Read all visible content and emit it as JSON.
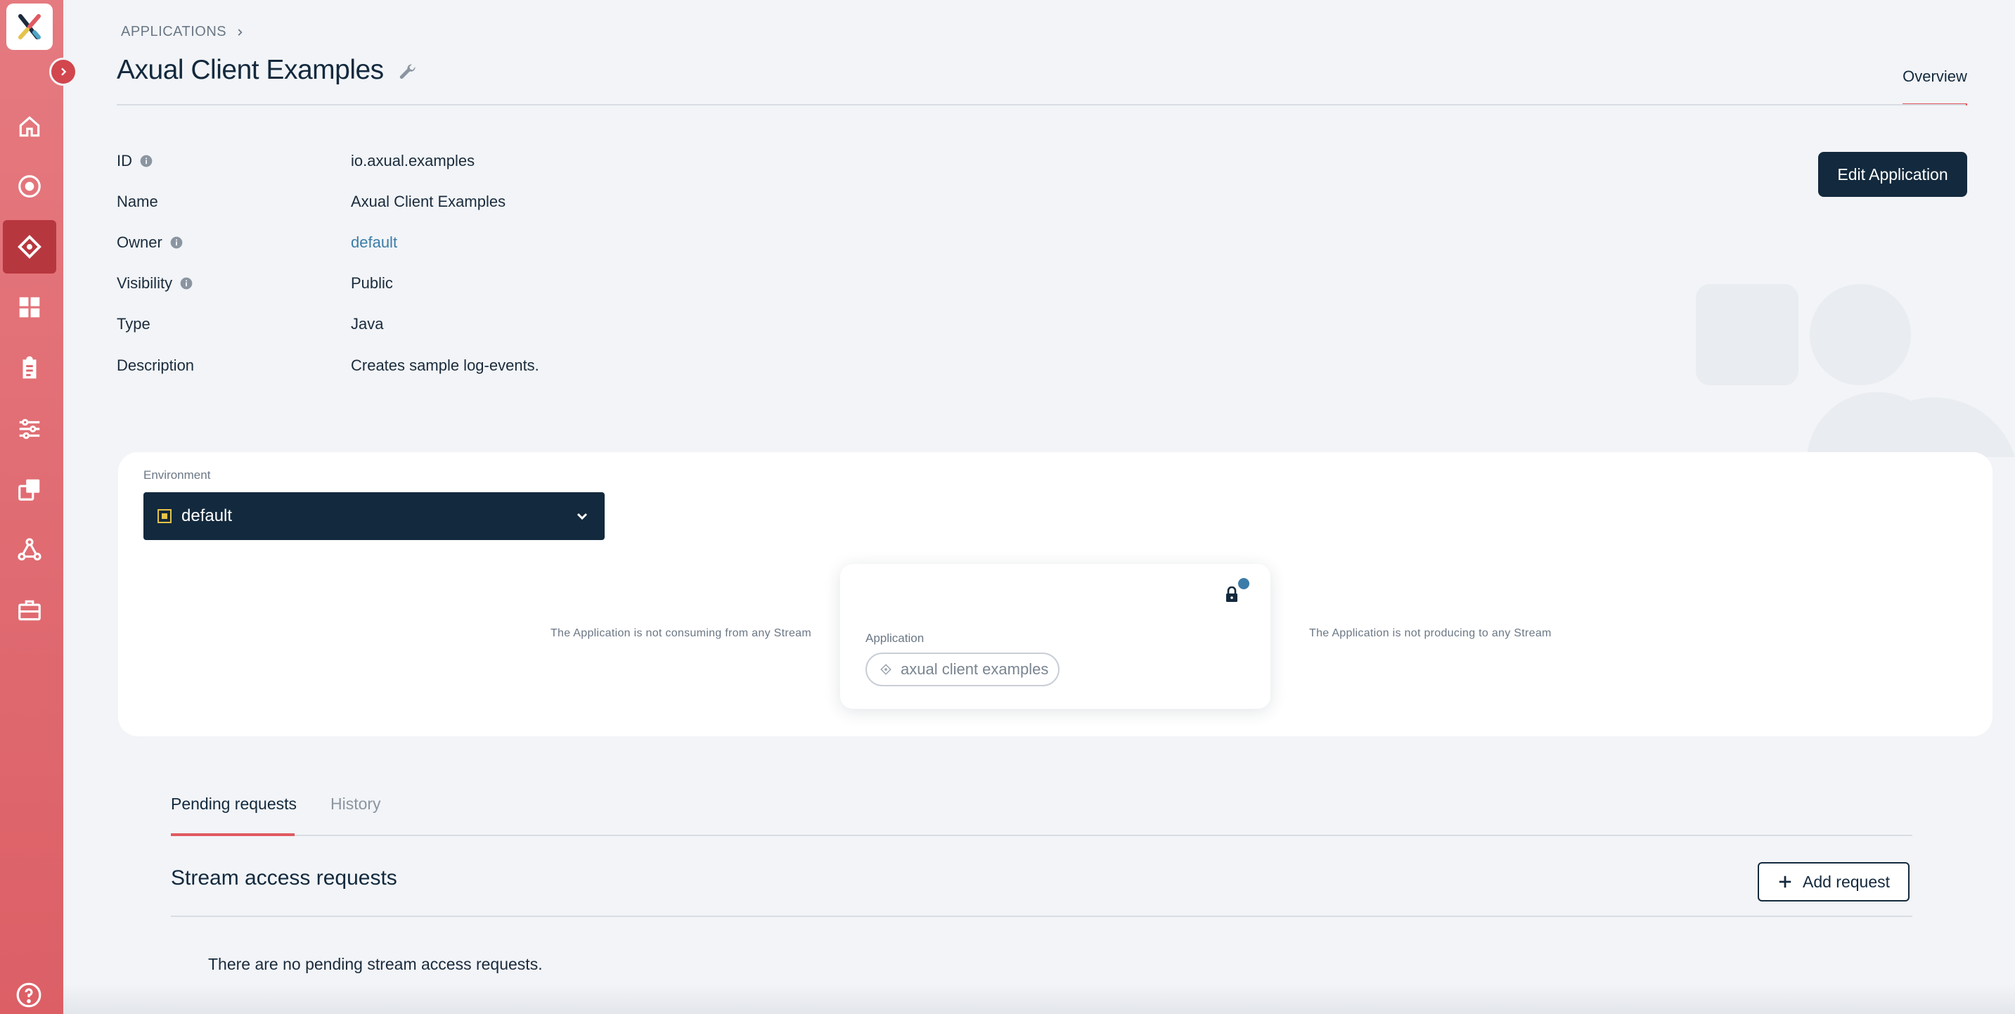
{
  "sidebar": {
    "items": [
      {
        "icon": "home-icon"
      },
      {
        "icon": "stream-icon"
      },
      {
        "icon": "application-icon",
        "active": true
      },
      {
        "icon": "dashboard-icon"
      },
      {
        "icon": "clipboard-icon"
      },
      {
        "icon": "settings-sliders-icon"
      },
      {
        "icon": "copy-icon"
      },
      {
        "icon": "network-icon"
      },
      {
        "icon": "briefcase-icon"
      }
    ],
    "help_icon": "help-icon"
  },
  "breadcrumb": {
    "label": "APPLICATIONS"
  },
  "header": {
    "title": "Axual Client Examples",
    "tab_overview": "Overview"
  },
  "actions": {
    "edit_label": "Edit Application"
  },
  "details": {
    "id_label": "ID",
    "id_value": "io.axual.examples",
    "name_label": "Name",
    "name_value": "Axual Client Examples",
    "owner_label": "Owner",
    "owner_value": "default",
    "visibility_label": "Visibility",
    "visibility_value": "Public",
    "type_label": "Type",
    "type_value": "Java",
    "description_label": "Description",
    "description_value": "Creates sample log-events."
  },
  "environment": {
    "label": "Environment",
    "selected": "default",
    "consuming_text": "The Application is not consuming from any Stream",
    "producing_text": "The Application is not producing to any Stream"
  },
  "app_card": {
    "label": "Application",
    "chip": "axual client examples"
  },
  "requests": {
    "tab_pending": "Pending requests",
    "tab_history": "History",
    "section_title": "Stream access requests",
    "add_label": "Add request",
    "empty_message": "There are no pending stream access requests."
  },
  "colors": {
    "sidebar": "#dc5f66",
    "sidebar_active": "#b7373f",
    "primary": "#13293d",
    "accent": "#e05a62",
    "link": "#3c7ca8"
  }
}
